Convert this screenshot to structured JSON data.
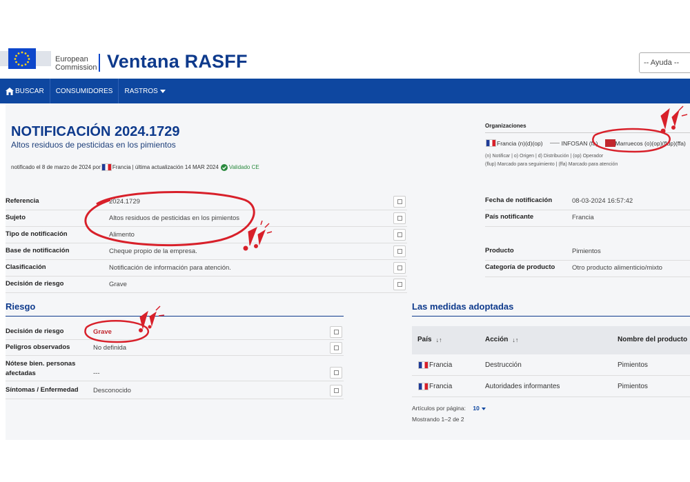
{
  "header": {
    "ec_line1": "European",
    "ec_line2": "Commission",
    "app_title": "Ventana RASFF",
    "help_select": "-- Ayuda --"
  },
  "nav": {
    "search": "BUSCAR",
    "consumers": "CONSUMIDORES",
    "traces": "RASTROS"
  },
  "notification": {
    "title": "NOTIFICACIÓN 2024.1729",
    "subtitle": "Altos residuos de pesticidas en los pimientos",
    "meta_prefix": "notificado el 8 de marzo de 2024 por",
    "meta_country": "Francia",
    "meta_update": "| última actualización 14 MAR 2024",
    "validated": "Validado CE"
  },
  "organizations": {
    "title": "Organizaciones",
    "items": [
      {
        "label": "Francia (n)(d)(op)",
        "flag": "fr"
      },
      {
        "label": "INFOSAN (fa)",
        "flag": "none"
      },
      {
        "label": "Marruecos (o)(op)(flup)(ffa)",
        "flag": "ma"
      }
    ],
    "legend_line1": "(n) Notificar | o) Origen | d) Distribución | (op) Operador",
    "legend_line2": "(flup) Marcado para seguimiento | (ffa) Marcado para atención"
  },
  "details_left": [
    {
      "label": "Referencia",
      "value": "2024.1729"
    },
    {
      "label": "Sujeto",
      "value": "Altos residuos de pesticidas en los pimientos"
    },
    {
      "label": "Tipo de notificación",
      "value": "Alimento"
    },
    {
      "label": "Base de notificación",
      "value": "Cheque propio de la empresa."
    },
    {
      "label": "Clasificación",
      "value": "Notificación de información para atención."
    },
    {
      "label": "Decisión de riesgo",
      "value": "Grave"
    }
  ],
  "details_right_top": [
    {
      "label": "Fecha de notificación",
      "value": "08-03-2024 16:57:42"
    },
    {
      "label": "País notificante",
      "value": "Francia"
    }
  ],
  "details_right_bottom": [
    {
      "label": "Producto",
      "value": "Pimientos"
    },
    {
      "label": "Categoría de producto",
      "value": "Otro producto alimenticio/mixto"
    }
  ],
  "risk": {
    "title": "Riesgo",
    "rows": [
      {
        "label": "Decisión de riesgo",
        "value": "Grave"
      },
      {
        "label": "Peligros observados",
        "value": "No definida"
      },
      {
        "label": "Nótese bien. personas afectadas",
        "value": "---"
      },
      {
        "label": "Síntomas / Enfermedad",
        "value": "Desconocido"
      }
    ],
    "highlight_color": "#c0262d"
  },
  "measures": {
    "title": "Las medidas adoptadas",
    "columns": [
      "País",
      "Acción",
      "Nombre del producto"
    ],
    "rows": [
      {
        "country": "Francia",
        "action": "Destrucción",
        "product": "Pimientos"
      },
      {
        "country": "Francia",
        "action": "Autoridades informantes",
        "product": "Pimientos"
      }
    ],
    "per_page_label": "Artículos por página:",
    "per_page_value": "10",
    "showing": "Mostrando 1–2 de 2"
  },
  "colors": {
    "brand_blue": "#0e3a8c",
    "nav_blue": "#0e47a0",
    "annotation_red": "#d8202a"
  }
}
